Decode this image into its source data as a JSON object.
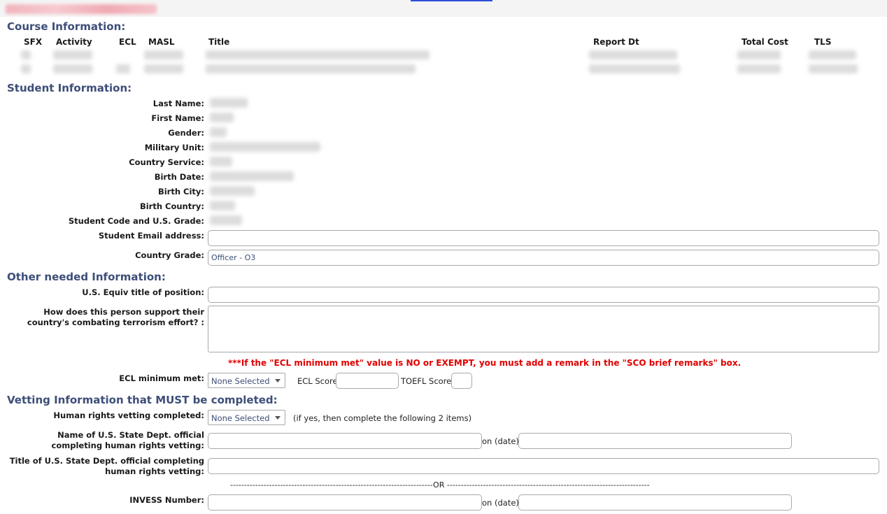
{
  "sections": {
    "course": "Course Information:",
    "student": "Student Information:",
    "other": "Other needed Information:",
    "vetting": "Vetting Information that MUST be completed:"
  },
  "course_columns": [
    "SFX",
    "Activity",
    "ECL",
    "MASL",
    "Title",
    "Report Dt",
    "Total Cost",
    "TLS"
  ],
  "student_labels": {
    "last_name": "Last Name:",
    "first_name": "First Name:",
    "gender": "Gender:",
    "military_unit": "Military Unit:",
    "country_service": "Country Service:",
    "birth_date": "Birth Date:",
    "birth_city": "Birth City:",
    "birth_country": "Birth Country:",
    "student_code": "Student Code and U.S. Grade:",
    "email": "Student Email address:",
    "country_grade": "Country Grade:"
  },
  "fields": {
    "email_value": "",
    "country_grade_value": "Officer - O3",
    "equiv_title_value": "",
    "support_value": "",
    "ecl_score_value": "",
    "toefl_score_value": "",
    "official_name_value": "",
    "official_date_value": "",
    "official_title_value": "",
    "invess_value": "",
    "invess_date_value": ""
  },
  "other_labels": {
    "equiv_title": "U.S. Equiv title of position:",
    "support_line1": "How does this person support their",
    "support_line2": "country's combating terrorism effort? :",
    "warning": "***If the \"ECL minimum met\" value is NO or EXEMPT, you must add a remark in the \"SCO brief remarks\" box.",
    "ecl_min": "ECL minimum met:",
    "ecl_min_selected": "None Selected",
    "ecl_score": "ECL Score:",
    "toefl_score": "TOEFL Score:"
  },
  "vetting_labels": {
    "hr_vetting": "Human rights vetting completed:",
    "hr_selected": "None Selected",
    "hr_hint": "(if yes, then complete the following 2 items)",
    "official_name_line1": "Name of U.S. State Dept. official",
    "official_name_line2": "completing human rights vetting:",
    "on_date": "on (date)",
    "official_title_line1": "Title of U.S. State Dept. official completing",
    "official_title_line2": "human rights vetting:",
    "or_separator": "-------------------------------------------------------------------------OR -------------------------------------------------------------------------",
    "invess": "INVESS Number:",
    "on_date2": "on (date)"
  },
  "colors": {
    "section": "#3d4e78",
    "warning": "#e00000",
    "border": "#a9a9a9"
  }
}
